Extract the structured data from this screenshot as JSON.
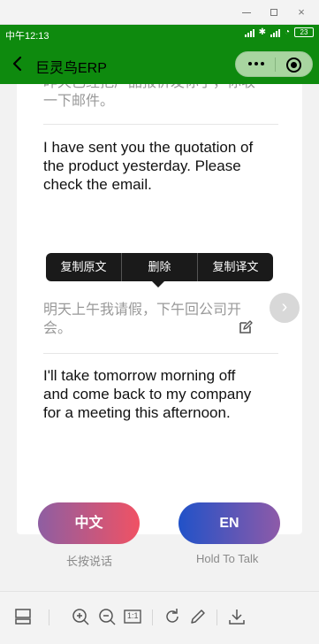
{
  "window": {
    "min_label": "—",
    "max_label": "□",
    "close_label": "×"
  },
  "status_bar": {
    "time": "中午12:13",
    "battery": "23"
  },
  "header": {
    "title": "巨灵鸟ERP",
    "icons": [
      "back-arrow-icon",
      "more-dots-icon",
      "record-target-icon"
    ]
  },
  "card1": {
    "source_text": "昨天已经把产品报价发你了，你收一下邮件。",
    "translation": "I have sent you the quotation of the product yesterday. Please check the email."
  },
  "popup": {
    "copy_source": "复制原文",
    "delete": "删除",
    "copy_translation": "复制译文"
  },
  "card2": {
    "source_text": "明天上午我请假，下午回公司开会。",
    "translation": "I'll take tomorrow morning off and come back to my company for a meeting this afternoon."
  },
  "talk": {
    "zh_button": "中文",
    "en_button": "EN",
    "zh_hint": "长按说话",
    "en_hint": "Hold To Talk"
  },
  "toolbar": {
    "icons": [
      "layout-icon",
      "zoom-in-icon",
      "zoom-out-icon",
      "actual-size-icon",
      "rotate-icon",
      "edit-pen-icon",
      "download-icon"
    ],
    "actual_size_label": "1:1"
  },
  "colors": {
    "primary_green": "#0e8a0e",
    "zh_gradient": [
      "#8e5ea2",
      "#f05264"
    ],
    "en_gradient": [
      "#2152c8",
      "#8e5aa8"
    ]
  }
}
